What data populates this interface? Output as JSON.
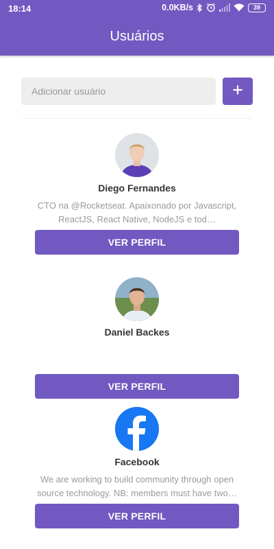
{
  "status_bar": {
    "time": "18:14",
    "network_speed": "0.0KB/s",
    "battery": "39",
    "icons": [
      "bluetooth-icon",
      "alarm-icon",
      "signal-icon",
      "wifi-icon",
      "battery-icon"
    ]
  },
  "header": {
    "title": "Usuários"
  },
  "form": {
    "placeholder": "Adicionar usuário",
    "add_icon": "plus-icon"
  },
  "users": [
    {
      "name": "Diego Fernandes",
      "bio": "CTO na @Rocketseat. Apaixonado por Javascript, ReactJS, React Native, NodeJS e tod…",
      "button": "VER PERFIL",
      "avatar": "person-avatar"
    },
    {
      "name": "Daniel Backes",
      "bio": "",
      "button": "VER PERFIL",
      "avatar": "person-avatar"
    },
    {
      "name": "Facebook",
      "bio": "We are working to build community through open source technology. NB: members must have two…",
      "button": "VER PERFIL",
      "avatar": "facebook-logo"
    }
  ],
  "colors": {
    "primary": "#7159c1",
    "input_bg": "#eeeeee",
    "bio_text": "#999999",
    "name_text": "#333333",
    "facebook_blue": "#1877f2"
  }
}
